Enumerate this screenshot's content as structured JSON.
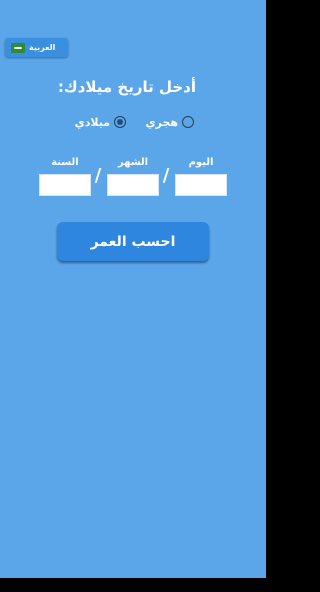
{
  "language_button": {
    "label": "العربية",
    "flag_icon": "saudi-flag-icon"
  },
  "title": "أدخل تاريخ ميلادك:",
  "calendar_type": {
    "options": [
      {
        "label": "هجري",
        "selected": false
      },
      {
        "label": "ميلادي",
        "selected": true
      }
    ]
  },
  "date_fields": {
    "day": {
      "label": "اليوم",
      "value": ""
    },
    "month": {
      "label": "الشهر",
      "value": ""
    },
    "year": {
      "label": "السنة",
      "value": ""
    },
    "separator": "/"
  },
  "calculate_button": {
    "label": "احسب العمر"
  },
  "colors": {
    "background": "#5aa6e8",
    "button": "#2e86de",
    "language_button": "#3b8fe0"
  }
}
